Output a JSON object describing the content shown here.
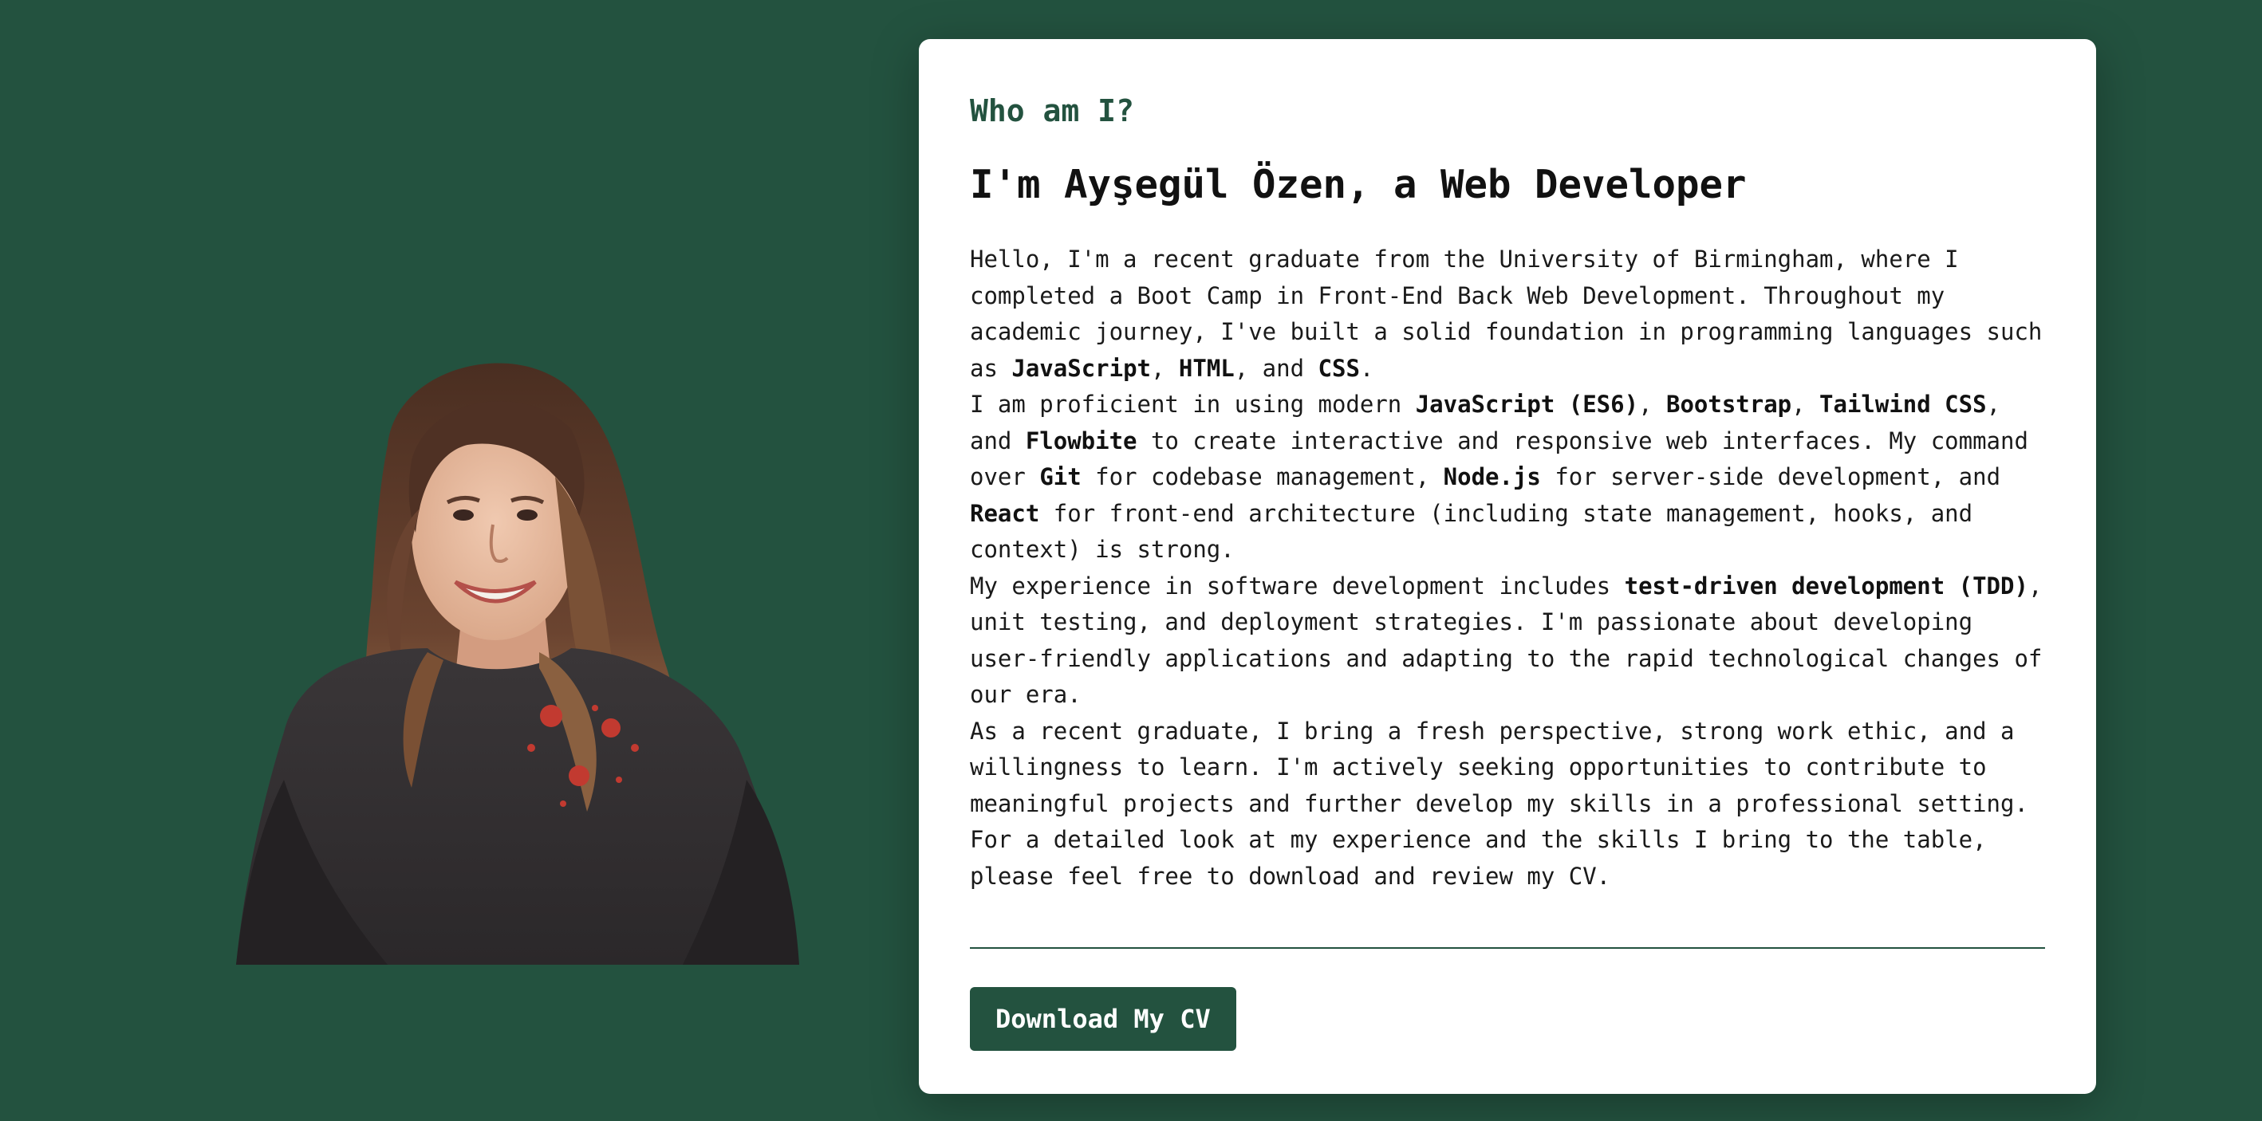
{
  "about": {
    "eyebrow": "Who am I?",
    "headline": "I'm Ayşegül Özen, a Web Developer",
    "paragraphs": [
      {
        "p1_a": "Hello, I'm a recent graduate from the University of Birmingham, where I completed a Boot Camp in Front-End Back Web Development. Throughout my academic journey, I've built a solid foundation in programming languages such as ",
        "p1_js": "JavaScript",
        "p1_b": ", ",
        "p1_html": "HTML",
        "p1_c": ", and ",
        "p1_css": "CSS",
        "p1_d": "."
      },
      {
        "p2_a": "I am proficient in using modern ",
        "p2_es6": "JavaScript (ES6)",
        "p2_b": ", ",
        "p2_bootstrap": "Bootstrap",
        "p2_c": ", ",
        "p2_tailwind": "Tailwind CSS",
        "p2_d": ", and ",
        "p2_flowbite": "Flowbite",
        "p2_e": " to create interactive and responsive web interfaces. My command over ",
        "p2_git": "Git",
        "p2_f": " for codebase management, ",
        "p2_node": "Node.js",
        "p2_g": " for server-side development, and ",
        "p2_react": "React",
        "p2_h": " for front-end architecture (including state management, hooks, and context) is strong."
      },
      {
        "p3_a": "My experience in software development includes ",
        "p3_tdd": "test-driven development (TDD)",
        "p3_b": ", unit testing, and deployment strategies. I'm passionate about developing user-friendly applications and adapting to the rapid technological changes of our era."
      },
      {
        "p4": "As a recent graduate, I bring a fresh perspective, strong work ethic, and a willingness to learn. I'm actively seeking opportunities to contribute to meaningful projects and further develop my skills in a professional setting."
      },
      {
        "p5": "For a detailed look at my experience and the skills I bring to the table, please feel free to download and review my CV."
      }
    ],
    "cv_button_label": "Download My CV"
  },
  "portrait": {
    "alt": "Portrait photo"
  },
  "colors": {
    "page_background": "#23523f",
    "card_background": "#ffffff",
    "accent": "#23523f",
    "button_text": "#ffffff"
  }
}
